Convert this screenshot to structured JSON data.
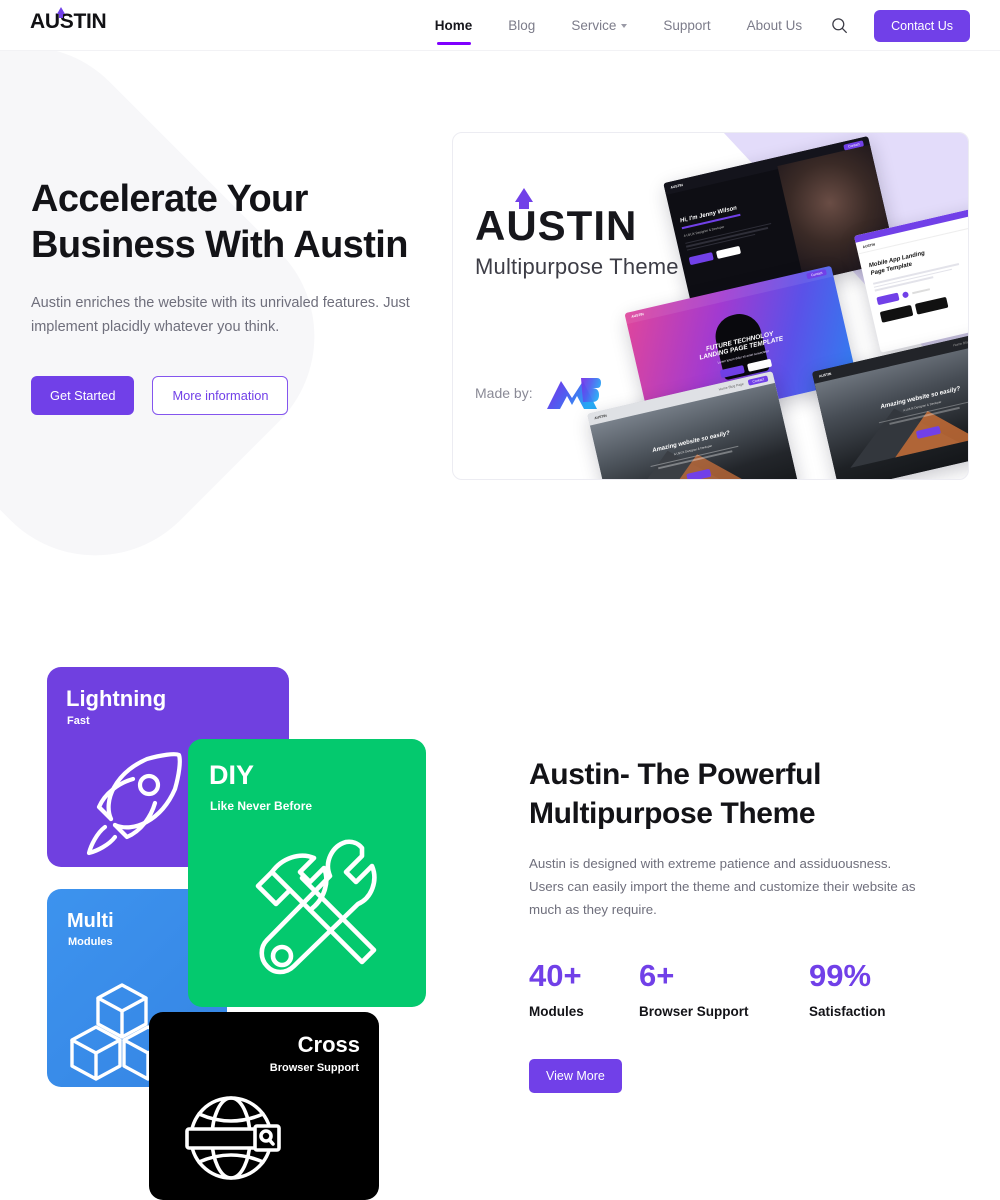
{
  "header": {
    "logo_text": "AUSTIN",
    "nav_items": [
      {
        "label": "Home",
        "active": true,
        "has_dropdown": false
      },
      {
        "label": "Blog",
        "active": false,
        "has_dropdown": false
      },
      {
        "label": "Service",
        "active": false,
        "has_dropdown": true
      },
      {
        "label": "Support",
        "active": false,
        "has_dropdown": false
      },
      {
        "label": "About Us",
        "active": false,
        "has_dropdown": false
      }
    ],
    "search_icon": "search-icon",
    "contact_button": "Contact Us"
  },
  "hero": {
    "title_line1": "Accelerate Your",
    "title_line2": "Business With Austin",
    "subtitle": "Austin enriches the website with its unrivaled features. Just implement placidly whatever you think.",
    "primary_button": "Get Started",
    "secondary_button": "More information",
    "promo": {
      "brand": "AUSTIN",
      "tagline": "Multipurpose Theme",
      "made_by_label": "Made by:",
      "made_by_logo": "mb-logo-icon",
      "mockups": [
        {
          "name": "portfolio-dark-mockup",
          "heading": "Hi, I'm Jenny Wilson"
        },
        {
          "name": "future-tech-mockup",
          "heading": "FUTURE TECHNOLOY LANDING PAGE TEMPLATE"
        },
        {
          "name": "mobile-app-mockup",
          "heading": "Mobile App Landing Page Template"
        },
        {
          "name": "mountain-light-mockup",
          "heading": "Amazing website so easily?"
        },
        {
          "name": "mountain-dark-mockup",
          "heading": "Amazing website so easily?"
        }
      ]
    }
  },
  "features": {
    "cards": [
      {
        "key": "lightning",
        "title": "Lightning",
        "subtitle": "Fast",
        "icon": "rocket-icon",
        "color": "#7040e0"
      },
      {
        "key": "diy",
        "title": "DIY",
        "subtitle": "Like Never Before",
        "icon": "hammer-wrench-icon",
        "color": "#04c96e"
      },
      {
        "key": "multi",
        "title": "Multi",
        "subtitle": "Modules",
        "icon": "cubes-icon",
        "color": "#3d93ee"
      },
      {
        "key": "cross",
        "title": "Cross",
        "subtitle": "Browser Support",
        "icon": "globe-search-icon",
        "color": "#000000"
      }
    ]
  },
  "about": {
    "title_line1": "Austin- The Powerful",
    "title_line2": "Multipurpose Theme",
    "paragraph": "Austin is designed with extreme patience and assiduousness. Users can easily import the theme and customize their website as much as they require.",
    "stats": [
      {
        "value": "40+",
        "label": "Modules"
      },
      {
        "value": "6+",
        "label": "Browser Support"
      },
      {
        "value": "99%",
        "label": "Satisfaction"
      }
    ],
    "button": "View More"
  },
  "colors": {
    "accent_purple": "#7140e8",
    "underline_purple": "#7f00ff",
    "green": "#04c96e",
    "blue": "#3d93ee",
    "black": "#000000",
    "text_dark": "#131317",
    "text_muted": "#6f6f7c"
  }
}
